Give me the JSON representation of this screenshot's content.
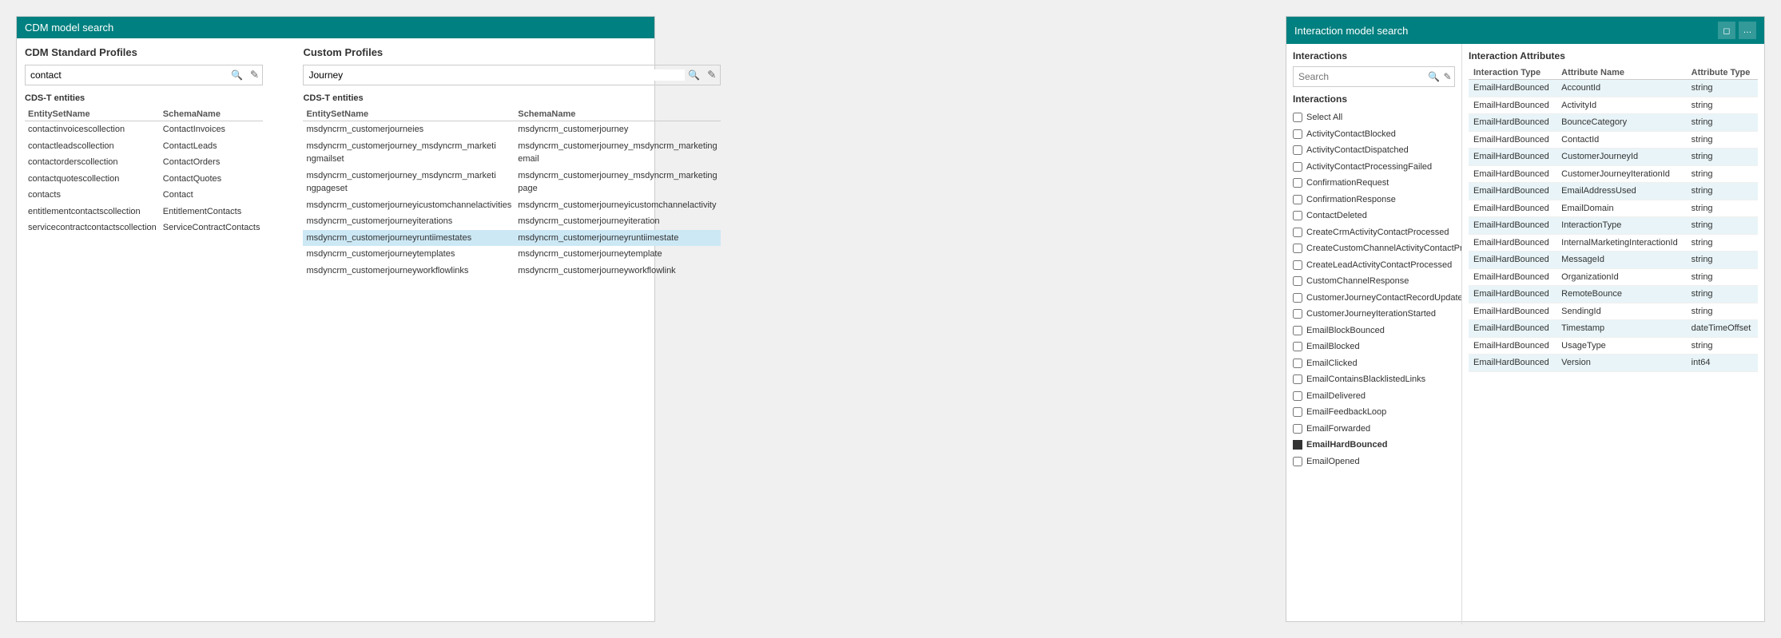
{
  "cdm_panel": {
    "title": "CDM model search",
    "standard_profiles": {
      "label": "CDM Standard Profiles",
      "search_value": "contact",
      "search_placeholder": "",
      "section_label": "CDS-T entities",
      "columns": [
        "EntitySetName",
        "SchemaName"
      ],
      "rows": [
        {
          "entity": "contactinvoicescollection",
          "schema": "ContactInvoices"
        },
        {
          "entity": "contactleadscollection",
          "schema": "ContactLeads"
        },
        {
          "entity": "contactorderscollection",
          "schema": "ContactOrders"
        },
        {
          "entity": "contactquotescollection",
          "schema": "ContactQuotes"
        },
        {
          "entity": "contacts",
          "schema": "Contact"
        },
        {
          "entity": "entitlementcontactscollection",
          "schema": "EntitlementContacts"
        },
        {
          "entity": "servicecontractcontactscollection",
          "schema": "ServiceContractContacts"
        }
      ]
    },
    "custom_profiles": {
      "label": "Custom Profiles",
      "search_value": "Journey",
      "search_placeholder": "",
      "section_label": "CDS-T entities",
      "columns": [
        "EntitySetName",
        "SchemaName"
      ],
      "rows": [
        {
          "entity": "msdyncrm_customerjourneies",
          "schema": "msdyncrm_customerjourney",
          "highlight": false
        },
        {
          "entity": "msdyncrm_customerjourney_msdyncrm_marketi ngmailset",
          "schema": "msdyncrm_customerjourney_msdyncrm_marketing email",
          "highlight": false
        },
        {
          "entity": "msdyncrm_customerjourney_msdyncrm_marketi ngpageset",
          "schema": "msdyncrm_customerjourney_msdyncrm_marketing page",
          "highlight": false
        },
        {
          "entity": "msdyncrm_customerjourneyicustomchannelactivities",
          "schema": "msdyncrm_customerjourneyicustomchannelactivity",
          "highlight": false
        },
        {
          "entity": "msdyncrm_customerjourneyiterations",
          "schema": "msdyncrm_customerjourneyiteration",
          "highlight": false
        },
        {
          "entity": "msdyncrm_customerjourneyruntiimestates",
          "schema": "msdyncrm_customerjourneyruntiimestate",
          "highlight": true
        },
        {
          "entity": "msdyncrm_customerjourneytemplates",
          "schema": "msdyncrm_customerjourneytemplate",
          "highlight": false
        },
        {
          "entity": "msdyncrm_customerjourneyworkflowlinks",
          "schema": "msdyncrm_customerjourneyworkflowlink",
          "highlight": false
        }
      ]
    }
  },
  "interaction_panel": {
    "title": "Interaction model search",
    "header_icons": [
      "window-icon",
      "more-icon"
    ],
    "interactions_section": {
      "label": "Interactions",
      "search_placeholder": "Search",
      "search_value": "",
      "list_section_label": "Interactions",
      "items": [
        {
          "label": "Select All",
          "checked": false,
          "selected": false
        },
        {
          "label": "ActivityContactBlocked",
          "checked": false,
          "selected": false
        },
        {
          "label": "ActivityContactDispatched",
          "checked": false,
          "selected": false
        },
        {
          "label": "ActivityContactProcessingFailed",
          "checked": false,
          "selected": false
        },
        {
          "label": "ConfirmationRequest",
          "checked": false,
          "selected": false
        },
        {
          "label": "ConfirmationResponse",
          "checked": false,
          "selected": false
        },
        {
          "label": "ContactDeleted",
          "checked": false,
          "selected": false
        },
        {
          "label": "CreateCrmActivityContactProcessed",
          "checked": false,
          "selected": false
        },
        {
          "label": "CreateCustomChannelActivityContactProc...",
          "checked": false,
          "selected": false
        },
        {
          "label": "CreateLeadActivityContactProcessed",
          "checked": false,
          "selected": false
        },
        {
          "label": "CustomChannelResponse",
          "checked": false,
          "selected": false
        },
        {
          "label": "CustomerJourneyContactRecordUpdated",
          "checked": false,
          "selected": false
        },
        {
          "label": "CustomerJourneyIterationStarted",
          "checked": false,
          "selected": false
        },
        {
          "label": "EmailBlockBounced",
          "checked": false,
          "selected": false
        },
        {
          "label": "EmailBlocked",
          "checked": false,
          "selected": false
        },
        {
          "label": "EmailClicked",
          "checked": false,
          "selected": false
        },
        {
          "label": "EmailContainsBlacklistedLinks",
          "checked": false,
          "selected": false
        },
        {
          "label": "EmailDelivered",
          "checked": false,
          "selected": false
        },
        {
          "label": "EmailFeedbackLoop",
          "checked": false,
          "selected": false
        },
        {
          "label": "EmailForwarded",
          "checked": false,
          "selected": false
        },
        {
          "label": "EmailHardBounced",
          "checked": false,
          "selected": true
        },
        {
          "label": "EmailOpened",
          "checked": false,
          "selected": false
        }
      ]
    },
    "attributes_section": {
      "label": "Interaction Attributes",
      "columns": [
        "Interaction Type",
        "Attribute Name",
        "Attribute Type"
      ],
      "rows": [
        {
          "type": "EmailHardBounced",
          "name": "AccountId",
          "attr_type": "string"
        },
        {
          "type": "EmailHardBounced",
          "name": "ActivityId",
          "attr_type": "string"
        },
        {
          "type": "EmailHardBounced",
          "name": "BounceCategory",
          "attr_type": "string"
        },
        {
          "type": "EmailHardBounced",
          "name": "ContactId",
          "attr_type": "string"
        },
        {
          "type": "EmailHardBounced",
          "name": "CustomerJourneyId",
          "attr_type": "string"
        },
        {
          "type": "EmailHardBounced",
          "name": "CustomerJourneyIterationId",
          "attr_type": "string"
        },
        {
          "type": "EmailHardBounced",
          "name": "EmailAddressUsed",
          "attr_type": "string"
        },
        {
          "type": "EmailHardBounced",
          "name": "EmailDomain",
          "attr_type": "string"
        },
        {
          "type": "EmailHardBounced",
          "name": "InteractionType",
          "attr_type": "string"
        },
        {
          "type": "EmailHardBounced",
          "name": "InternalMarketingInteractionId",
          "attr_type": "string"
        },
        {
          "type": "EmailHardBounced",
          "name": "MessageId",
          "attr_type": "string"
        },
        {
          "type": "EmailHardBounced",
          "name": "OrganizationId",
          "attr_type": "string"
        },
        {
          "type": "EmailHardBounced",
          "name": "RemoteBounce",
          "attr_type": "string"
        },
        {
          "type": "EmailHardBounced",
          "name": "SendingId",
          "attr_type": "string"
        },
        {
          "type": "EmailHardBounced",
          "name": "Timestamp",
          "attr_type": "dateTimeOffset"
        },
        {
          "type": "EmailHardBounced",
          "name": "UsageType",
          "attr_type": "string"
        },
        {
          "type": "EmailHardBounced",
          "name": "Version",
          "attr_type": "int64"
        }
      ]
    }
  }
}
